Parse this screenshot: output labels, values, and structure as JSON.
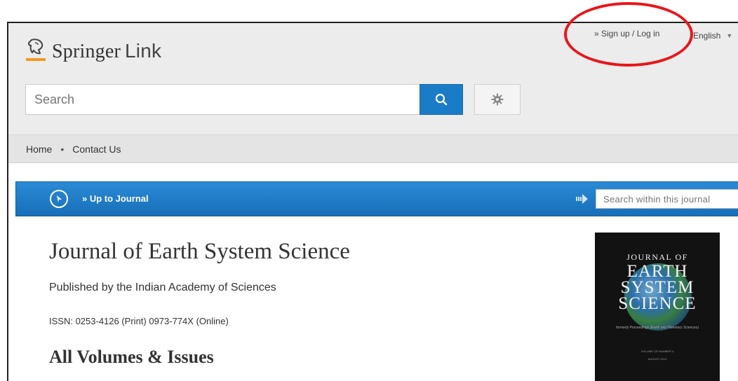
{
  "header": {
    "brand": "Springer",
    "brand_suffix": "Link",
    "signin_label": "» Sign up / Log in",
    "language_label": "English"
  },
  "search": {
    "placeholder": "Search"
  },
  "nav": {
    "home": "Home",
    "separator": "•",
    "contact": "Contact Us"
  },
  "journal_bar": {
    "up_label": "» Up to Journal",
    "search_within_placeholder": "Search within this journal"
  },
  "journal": {
    "title": "Journal of Earth System Science",
    "publisher": "Published by the Indian Academy of Sciences",
    "issn": "ISSN: 0253-4126 (Print) 0973-774X (Online)",
    "volumes_heading": "All Volumes & Issues"
  },
  "cover": {
    "line_top": "JOURNAL OF",
    "line1": "EARTH",
    "line2": "SYSTEM",
    "line3": "SCIENCE",
    "subtitle": "formerly Proceedings (Earth and Planetary Sciences)",
    "volume_line": "VOLUME 122  NUMBER 4",
    "date_line": "AUGUST 2013"
  },
  "colors": {
    "accent_blue": "#1a7cc7",
    "annotation_red": "#e8161b",
    "logo_orange": "#f39a1e"
  },
  "icons": [
    "springer-horse-icon",
    "search-icon",
    "gear-icon",
    "compass-icon",
    "arrow-right-icon",
    "caret-down-icon"
  ]
}
